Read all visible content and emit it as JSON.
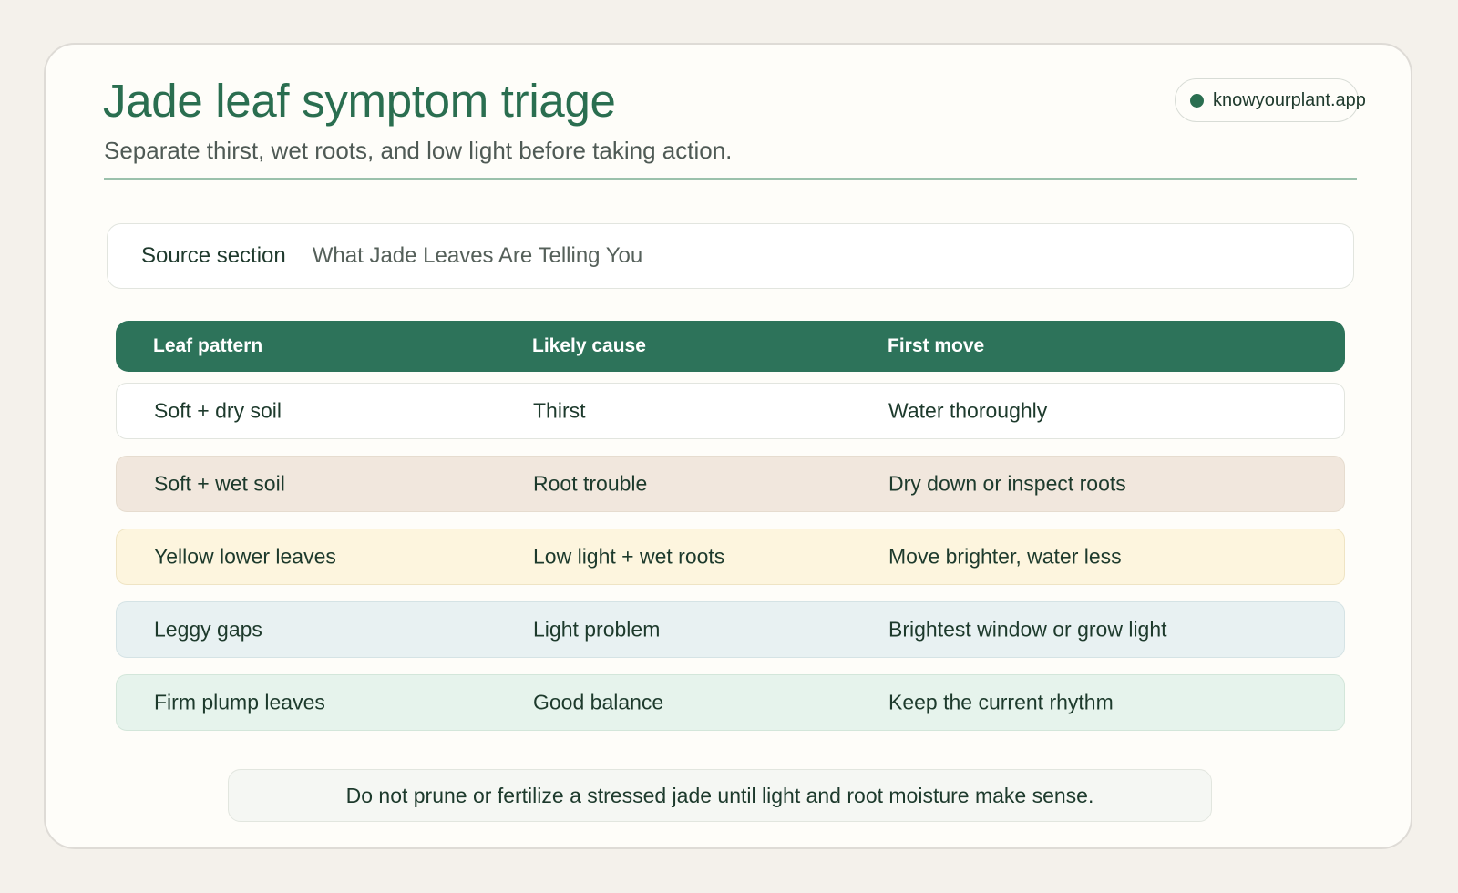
{
  "header": {
    "title": "Jade leaf symptom triage",
    "subtitle": "Separate thirst, wet roots, and low light before taking action.",
    "badge": "knowyourplant.app"
  },
  "source": {
    "label": "Source section",
    "value": "What Jade Leaves Are Telling You"
  },
  "table": {
    "headers": [
      "Leaf pattern",
      "Likely cause",
      "First move"
    ],
    "rows": [
      {
        "pattern": "Soft + dry soil",
        "cause": "Thirst",
        "move": "Water thoroughly",
        "bg": "#ffffff",
        "border": "#e2e5df"
      },
      {
        "pattern": "Soft + wet soil",
        "cause": "Root trouble",
        "move": "Dry down or inspect roots",
        "bg": "#f1e7dd",
        "border": "#e6dccf"
      },
      {
        "pattern": "Yellow lower leaves",
        "cause": "Low light + wet roots",
        "move": "Move brighter, water less",
        "bg": "#fdf5de",
        "border": "#efe4c4"
      },
      {
        "pattern": "Leggy gaps",
        "cause": "Light problem",
        "move": "Brightest window or grow light",
        "bg": "#e8f1f2",
        "border": "#d5e3e5"
      },
      {
        "pattern": "Firm plump leaves",
        "cause": "Good balance",
        "move": "Keep the current rhythm",
        "bg": "#e6f3ec",
        "border": "#d3e6da"
      }
    ]
  },
  "note": "Do not prune or fertilize a stressed jade until light and root moisture make sense.",
  "colors": {
    "accent": "#2a6e50",
    "header_bg": "#2d735a",
    "page_bg": "#f4f1eb",
    "card_bg": "#fefdf9"
  }
}
